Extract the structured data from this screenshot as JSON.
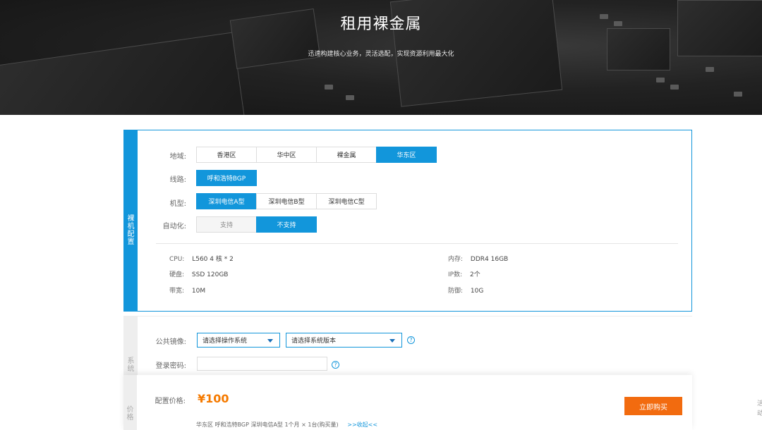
{
  "hero": {
    "title": "租用裸金属",
    "subtitle": "迅速构建核心业务，灵活选配，实现资源利用最大化"
  },
  "config": {
    "side_label": "裸机配置",
    "region": {
      "label": "地域:",
      "options": [
        "香港区",
        "华中区",
        "裸金属",
        "华东区"
      ],
      "selected_index": 3
    },
    "line": {
      "label": "线路:",
      "options": [
        "呼和浩特BGP"
      ],
      "selected_index": 0
    },
    "model": {
      "label": "机型:",
      "options": [
        "深圳电信A型",
        "深圳电信B型",
        "深圳电信C型"
      ],
      "selected_index": 0
    },
    "automation": {
      "label": "自动化:",
      "options": [
        "支持",
        "不支持"
      ],
      "selected_index": 1
    },
    "specs": {
      "cpu_label": "CPU:",
      "cpu_value": "L560   4 核 * 2",
      "disk_label": "硬盘:",
      "disk_value": "SSD 120GB",
      "bandwidth_label": "带宽:",
      "bandwidth_value": "10M",
      "memory_label": "内存:",
      "memory_value": "DDR4 16GB",
      "ip_label": "IP数:",
      "ip_value": "2个",
      "defense_label": "防御:",
      "defense_value": "10G"
    }
  },
  "system": {
    "side_label": "系统",
    "image_label": "公共镜像:",
    "os_select": "请选择操作系统",
    "version_select": "请选择系统版本",
    "password_label": "登录密码:",
    "password_value": ""
  },
  "price": {
    "side_label": "价格",
    "label": "配置价格:",
    "amount": "¥100",
    "buy_button": "立即购买",
    "summary": "华东区   呼和浩特BGP   深圳电信A型   1个月 × 1台(购买量)",
    "collapse_link": ">>收起<<"
  },
  "edge_text": "活动",
  "colors": {
    "accent": "#1296db",
    "buy": "#f26b0f",
    "price": "#f57a00"
  }
}
